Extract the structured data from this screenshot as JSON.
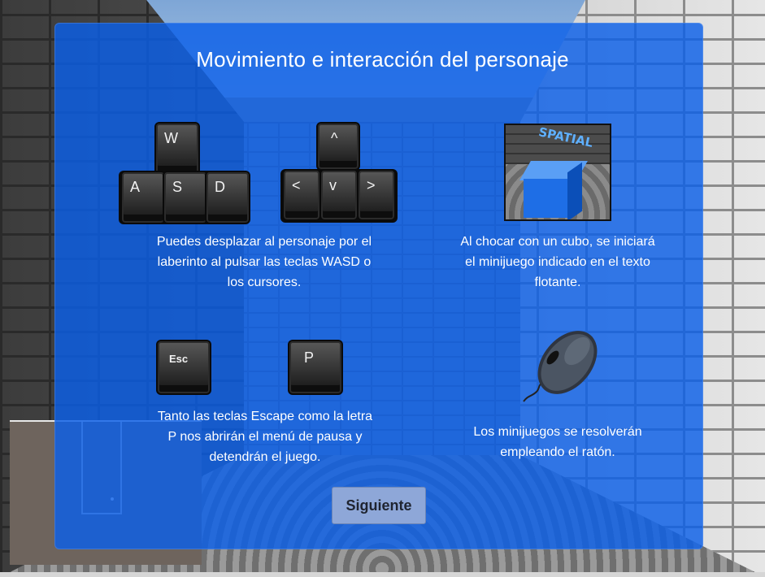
{
  "panel": {
    "title": "Movimiento e interacción del personaje"
  },
  "movement": {
    "wasd_keys": [
      "W",
      "A",
      "S",
      "D"
    ],
    "arrow_keys": [
      "^",
      "<",
      "v",
      ">"
    ],
    "description_lines": [
      "Puedes desplazar al personaje por el",
      "laberinto al pulsar las teclas WASD o",
      "los cursores."
    ]
  },
  "cube": {
    "graffiti": "SPATIAL",
    "description_lines": [
      "Al chocar con un cubo, se iniciará",
      "el minijuego indicado en el texto",
      "flotante."
    ]
  },
  "pause": {
    "keys": [
      "Esc",
      "P"
    ],
    "description_lines": [
      "Tanto las teclas Escape como la letra",
      "P nos abrirán el menú de pausa y",
      "detendrán el juego."
    ]
  },
  "mouse": {
    "icon": "mouse-icon",
    "description_lines": [
      "Los minijuegos se resolverán",
      "empleando el ratón."
    ]
  },
  "actions": {
    "next_label": "Siguiente"
  },
  "colors": {
    "panel": "#0b5fe8",
    "button": "#8ea7d8",
    "text": "#ffffff"
  }
}
